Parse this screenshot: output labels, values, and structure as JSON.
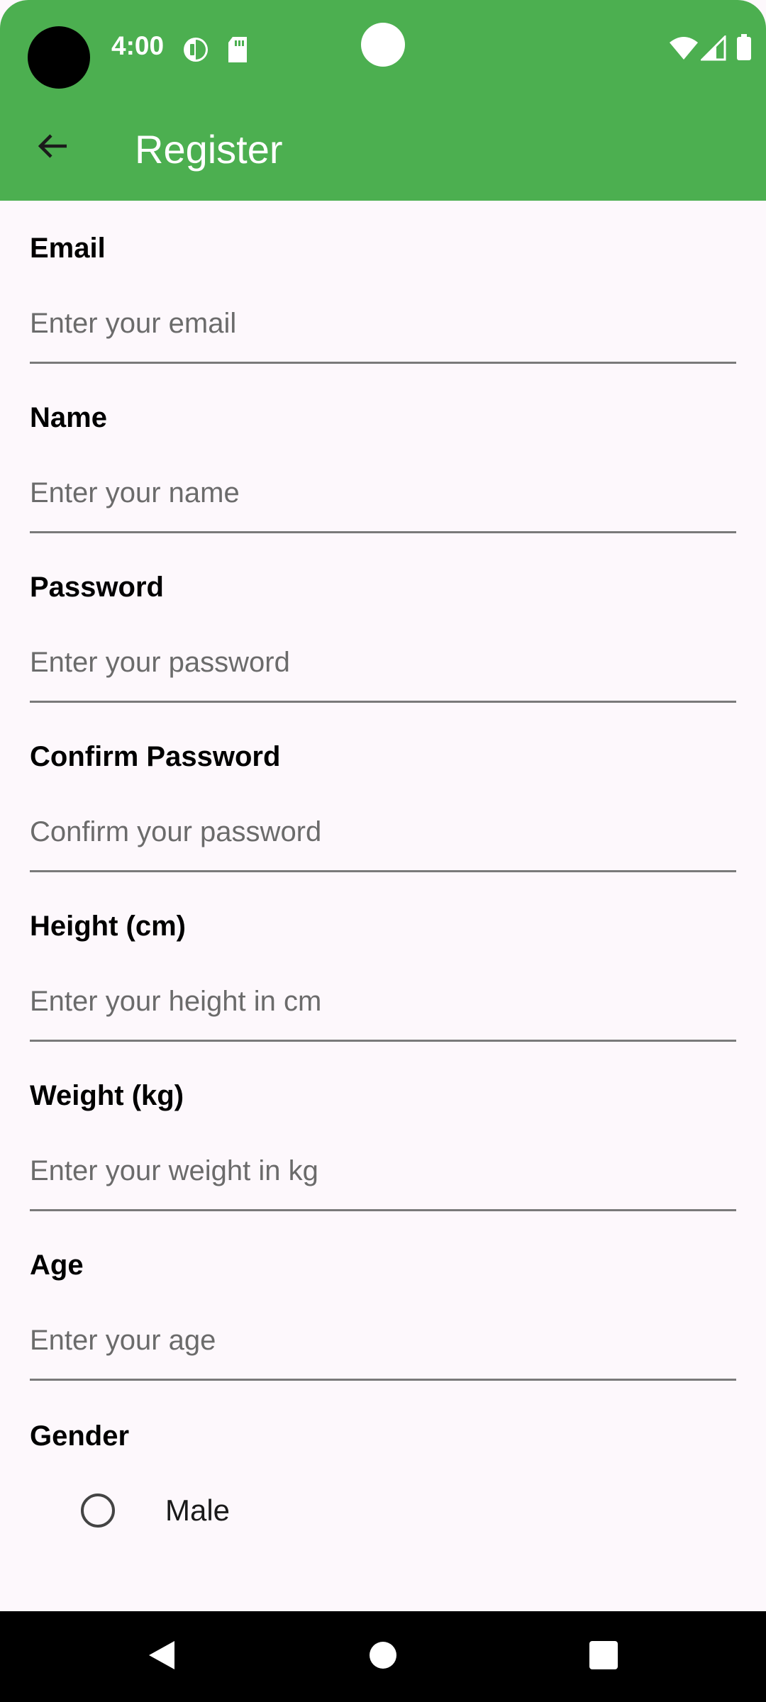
{
  "status_bar": {
    "time": "4:00",
    "icons": [
      "data-saver-icon",
      "sd-card-icon",
      "wifi-icon",
      "signal-icon",
      "battery-icon"
    ]
  },
  "app_bar": {
    "title": "Register",
    "back_icon": "arrow-back-icon",
    "background_color": "#4caf50"
  },
  "form": {
    "fields": [
      {
        "label": "Email",
        "placeholder": "Enter your email"
      },
      {
        "label": "Name",
        "placeholder": "Enter your name"
      },
      {
        "label": "Password",
        "placeholder": "Enter your password"
      },
      {
        "label": "Confirm Password",
        "placeholder": "Confirm your password"
      },
      {
        "label": "Height (cm)",
        "placeholder": "Enter your height in cm"
      },
      {
        "label": "Weight (kg)",
        "placeholder": "Enter your weight in kg"
      },
      {
        "label": "Age",
        "placeholder": "Enter your age"
      }
    ],
    "gender": {
      "label": "Gender",
      "options": [
        {
          "label": "Male",
          "selected": false
        }
      ]
    }
  },
  "nav_bar": {
    "icons": [
      "back-triangle-icon",
      "home-circle-icon",
      "recents-square-icon"
    ]
  }
}
